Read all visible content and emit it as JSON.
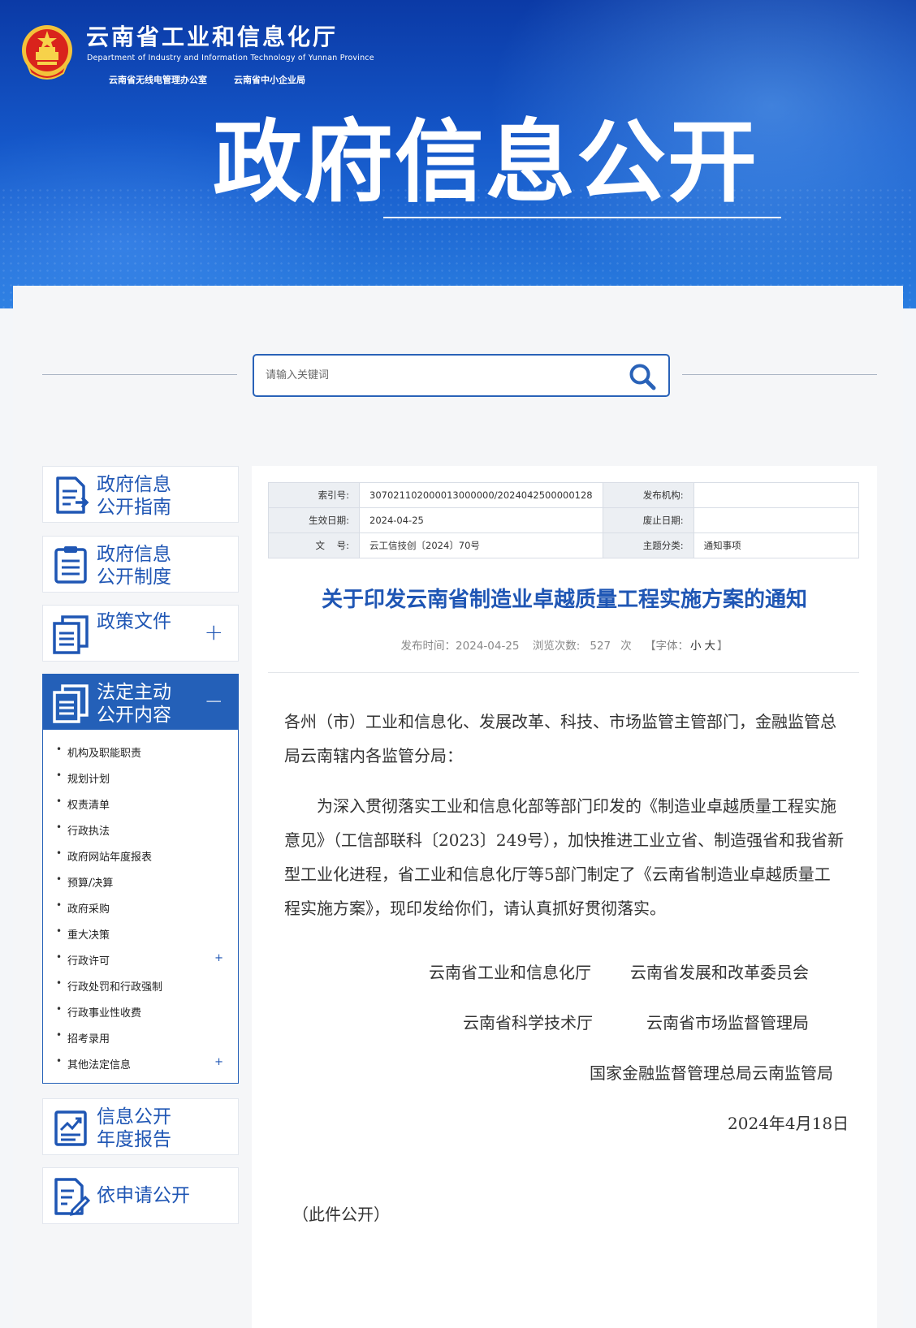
{
  "header": {
    "title_cn": "云南省工业和信息化厅",
    "title_en": "Department of Industry and Information Technology of Yunnan Province",
    "sub_offices": [
      "云南省无线电管理办公室",
      "云南省中小企业局"
    ],
    "banner": "政府信息公开"
  },
  "search": {
    "placeholder": "请输入关键词",
    "icon": "search-icon"
  },
  "sidebar": {
    "cards": [
      {
        "label_line1": "政府信息",
        "label_line2": "公开指南",
        "icon": "document-arrow-icon"
      },
      {
        "label_line1": "政府信息",
        "label_line2": "公开制度",
        "icon": "clipboard-list-icon"
      },
      {
        "label_line1": "政策文件",
        "toggle": "+",
        "icon": "stacked-docs-icon"
      },
      {
        "label_line1": "法定主动",
        "label_line2": "公开内容",
        "toggle": "−",
        "icon": "stacked-docs-icon"
      },
      {
        "label_line1": "信息公开",
        "label_line2": "年度报告",
        "icon": "chart-report-icon"
      },
      {
        "label_line1": "依申请公开",
        "icon": "document-pen-icon"
      }
    ],
    "sub_items": [
      "机构及职能职责",
      "规划计划",
      "权责清单",
      "行政执法",
      "政府网站年度报表",
      "预算/决算",
      "政府采购",
      "重大决策",
      "行政许可",
      "行政处罚和行政强制",
      "行政事业性收费",
      "招考录用",
      "其他法定信息"
    ],
    "sub_plus": "+"
  },
  "meta": {
    "index_label": "索引号:",
    "index_value": "307021102000013000000/2024042500000128",
    "org_label": "发布机构:",
    "org_value": "",
    "effective_label": "生效日期:",
    "effective_value": "2024-04-25",
    "expire_label": "废止日期:",
    "expire_value": "",
    "docno_label": "文    号:",
    "docno_value": "云工信技创〔2024〕70号",
    "topic_label": "主题分类:",
    "topic_value": "通知事项"
  },
  "article": {
    "title": "关于印发云南省制造业卓越质量工程实施方案的通知",
    "publish_time": "发布时间：2024-04-25",
    "views_label": "浏览次数:",
    "views": "527",
    "views_unit": "次",
    "font_label": "【字体：",
    "font_small": "小",
    "font_large": "大",
    "font_close": "】",
    "salutation": "各州（市）工业和信息化、发展改革、科技、市场监管主管部门，金融监管总局云南辖内各监管分局：",
    "body": "为深入贯彻落实工业和信息化部等部门印发的《制造业卓越质量工程实施意见》（工信部联科〔2023〕249号），加快推进工业立省、制造强省和我省新型工业化进程，省工业和信息化厅等5部门制定了《云南省制造业卓越质量工程实施方案》，现印发给你们，请认真抓好贯彻落实。",
    "signers": [
      "云南省工业和信息化厅",
      "云南省发展和改革委员会",
      "云南省科学技术厅",
      "云南省市场监督管理局",
      "国家金融监督管理总局云南监管局"
    ],
    "date": "2024年4月18日",
    "note": "（此件公开）"
  },
  "colors": {
    "brand_blue": "#1f56b4",
    "header_dark": "#0b3aa6",
    "active_card": "#2460b8"
  }
}
